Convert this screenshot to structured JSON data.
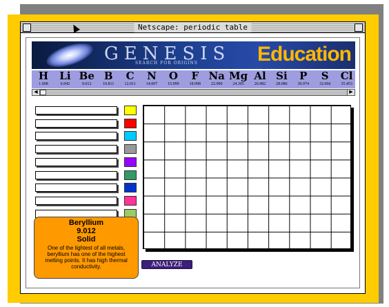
{
  "window": {
    "title": "Netscape: periodic table"
  },
  "banner": {
    "logo_text": "GENESIS",
    "tagline": "SEARCH FOR ORIGINS",
    "section": "Education"
  },
  "elements": [
    {
      "symbol": "H",
      "mass": "1.008"
    },
    {
      "symbol": "Li",
      "mass": "6.942"
    },
    {
      "symbol": "Be",
      "mass": "9.012"
    },
    {
      "symbol": "B",
      "mass": "10.811"
    },
    {
      "symbol": "C",
      "mass": "12.011"
    },
    {
      "symbol": "N",
      "mass": "14.007"
    },
    {
      "symbol": "O",
      "mass": "15.999"
    },
    {
      "symbol": "F",
      "mass": "18.998"
    },
    {
      "symbol": "Na",
      "mass": "22.990"
    },
    {
      "symbol": "Mg",
      "mass": "24.305"
    },
    {
      "symbol": "Al",
      "mass": "26.982"
    },
    {
      "symbol": "Si",
      "mass": "28.086"
    },
    {
      "symbol": "P",
      "mass": "30.974"
    },
    {
      "symbol": "S",
      "mass": "32.066"
    },
    {
      "symbol": "Cl",
      "mass": "35.453"
    }
  ],
  "scroll_icons": {
    "left": "left-arrow-icon",
    "right": "right-arrow-icon"
  },
  "swatch_colors": [
    "#ffff00",
    "#ff0000",
    "#00ccff",
    "#999999",
    "#9900ff",
    "#339966",
    "#0033cc",
    "#ff3399",
    "#99cc66"
  ],
  "info": {
    "name": "Beryllium",
    "weight": "9.012",
    "state": "Solid",
    "description": "One of the lightest of all metals, beryllium has one of the highest melting points.  It has high thermal conductivity."
  },
  "analyze": {
    "label": "ANALYZE"
  }
}
